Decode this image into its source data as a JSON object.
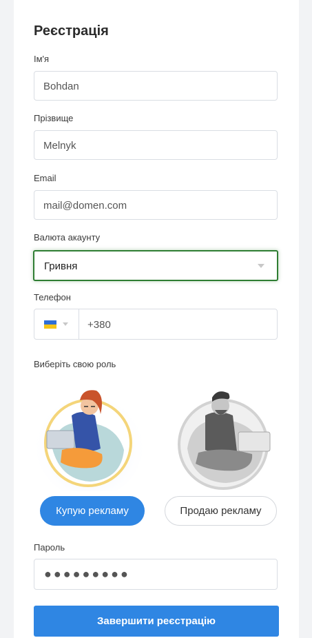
{
  "form": {
    "title": "Реєстрація",
    "first_name": {
      "label": "Ім'я",
      "value": "Bohdan"
    },
    "last_name": {
      "label": "Прізвище",
      "value": "Melnyk"
    },
    "email": {
      "label": "Email",
      "value": "mail@domen.com"
    },
    "currency": {
      "label": "Валюта акаунту",
      "value": "Гривня"
    },
    "phone": {
      "label": "Телефон",
      "value": "+380",
      "country_icon": "ukraine-flag-icon"
    },
    "role": {
      "label": "Виберіть свою роль",
      "buy_label": "Купую рекламу",
      "sell_label": "Продаю рекламу",
      "selected": "buy"
    },
    "password": {
      "label": "Пароль",
      "value": "●●●●●●●●●"
    },
    "submit_label": "Завершити реєстрацію"
  },
  "colors": {
    "primary": "#2f86e3",
    "focus_border": "#2e7d32",
    "flag_blue": "#2f6fd6",
    "flag_yellow": "#f5c518"
  }
}
